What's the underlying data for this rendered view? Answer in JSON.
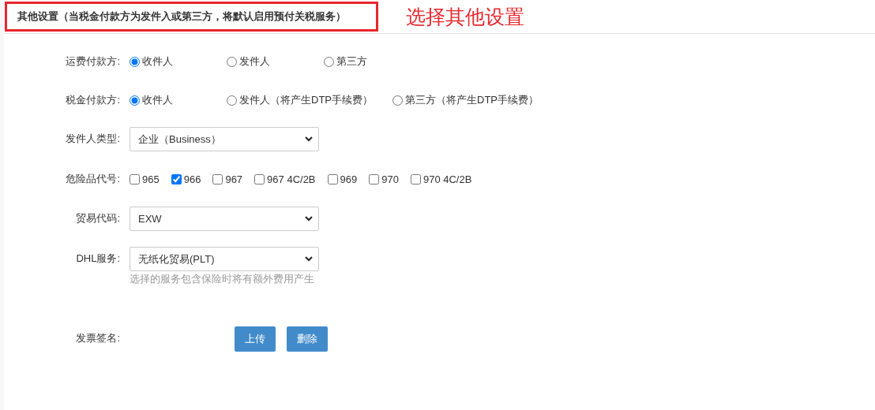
{
  "header": {
    "title": "其他设置（当税金付款方为发件入或第三方，将默认启用预付关税服务）",
    "highlighted": true
  },
  "annotation": "选择其他设置",
  "form": [
    {
      "kind": "radio",
      "label": "运费付款方:",
      "options": [
        {
          "label": "收件人",
          "selected": true
        },
        {
          "label": "发件人",
          "selected": false
        },
        {
          "label": "第三方",
          "selected": false
        }
      ]
    },
    {
      "kind": "radio",
      "label": "税金付款方:",
      "options": [
        {
          "label": "收件人",
          "selected": true
        },
        {
          "label": "发件人（将产生DTP手续费）",
          "selected": false
        },
        {
          "label": "第三方（将产生DTP手续费）",
          "selected": false
        }
      ]
    },
    {
      "kind": "select",
      "label": "发件人类型:",
      "value": "企业（Business）"
    },
    {
      "kind": "checkbox",
      "label": "危险品代号:",
      "options": [
        {
          "label": "965",
          "checked": false
        },
        {
          "label": "966",
          "checked": true
        },
        {
          "label": "967",
          "checked": false
        },
        {
          "label": "967 4C/2B",
          "checked": false
        },
        {
          "label": "969",
          "checked": false
        },
        {
          "label": "970",
          "checked": false
        },
        {
          "label": "970 4C/2B",
          "checked": false
        }
      ]
    },
    {
      "kind": "select",
      "label": "贸易代码:",
      "value": "EXW"
    },
    {
      "kind": "select",
      "label": "DHL服务:",
      "value": "无纸化贸易(PLT)",
      "hint": "选择的服务包含保险时将有额外费用产生"
    },
    {
      "kind": "buttons",
      "label": "发票签名:",
      "buttons": [
        "上传",
        "删除"
      ]
    }
  ]
}
